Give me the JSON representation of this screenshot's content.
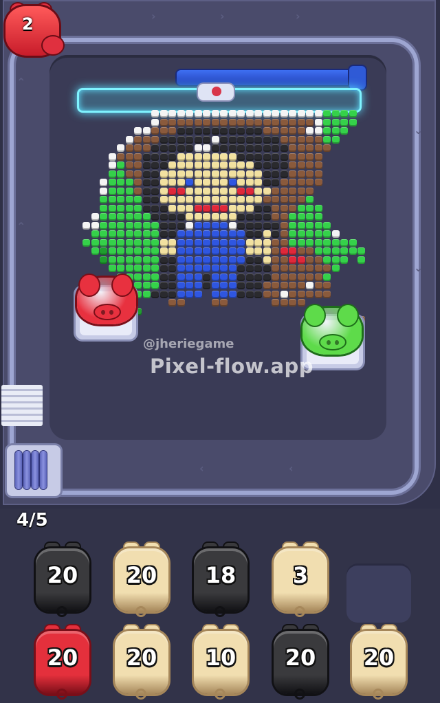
{
  "hud": {
    "corner_pig_count": "2",
    "progress_counter": "4/5"
  },
  "watermark": {
    "handle": "@jheriegame",
    "site": "Pixel-flow.app"
  },
  "colors": {
    "background": "#2f3047",
    "track": "#4a4b6b",
    "board": "#3a3b56",
    "laser": "#7ff3ff",
    "blue_bar": "#3e6ff2",
    "pixel_palette": {
      "W": "#f4f4f4",
      "K": "#2a2a2e",
      "B": "#8a5a3c",
      "S": "#f2e1a0",
      "G": "#35d14a",
      "U": "#2f56e0",
      "R": "#e0283a",
      "D": "#1f9e2e"
    }
  },
  "board_pigs": [
    {
      "color": "red",
      "fill": "#e8313f"
    },
    {
      "color": "green",
      "fill": "#5edb4a"
    }
  ],
  "pig_colors": {
    "black": {
      "fill": "#3a3a3d",
      "edge": "#111114"
    },
    "cream": {
      "fill": "#f1deb0",
      "edge": "#a6875a"
    },
    "red": {
      "fill": "#e4303c",
      "edge": "#7a0e18"
    }
  },
  "inventory": [
    [
      {
        "color": "black",
        "count": "20"
      },
      {
        "color": "cream",
        "count": "20"
      },
      {
        "color": "black",
        "count": "18"
      },
      {
        "color": "cream",
        "count": "3"
      },
      {
        "color": "empty",
        "count": ""
      }
    ],
    [
      {
        "color": "red",
        "count": "20"
      },
      {
        "color": "cream",
        "count": "20"
      },
      {
        "color": "cream",
        "count": "10"
      },
      {
        "color": "black",
        "count": "20"
      },
      {
        "color": "cream",
        "count": "20"
      }
    ]
  ]
}
